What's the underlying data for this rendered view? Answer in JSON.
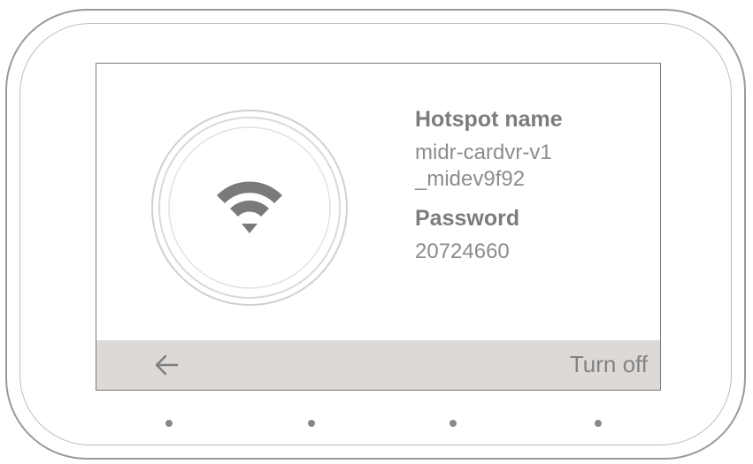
{
  "hotspot": {
    "name_label": "Hotspot name",
    "name_line1": "midr-cardvr-v1",
    "name_line2": "_midev9f92",
    "password_label": "Password",
    "password_value": "20724660"
  },
  "bottom_bar": {
    "back_icon": "arrow-left-icon",
    "turn_off_label": "Turn off"
  },
  "icons": {
    "center": "wifi-icon"
  },
  "colors": {
    "bottom_bar_bg": "#dcd9d7",
    "text_gray": "#808080",
    "icon_gray": "#7a7a7a"
  }
}
